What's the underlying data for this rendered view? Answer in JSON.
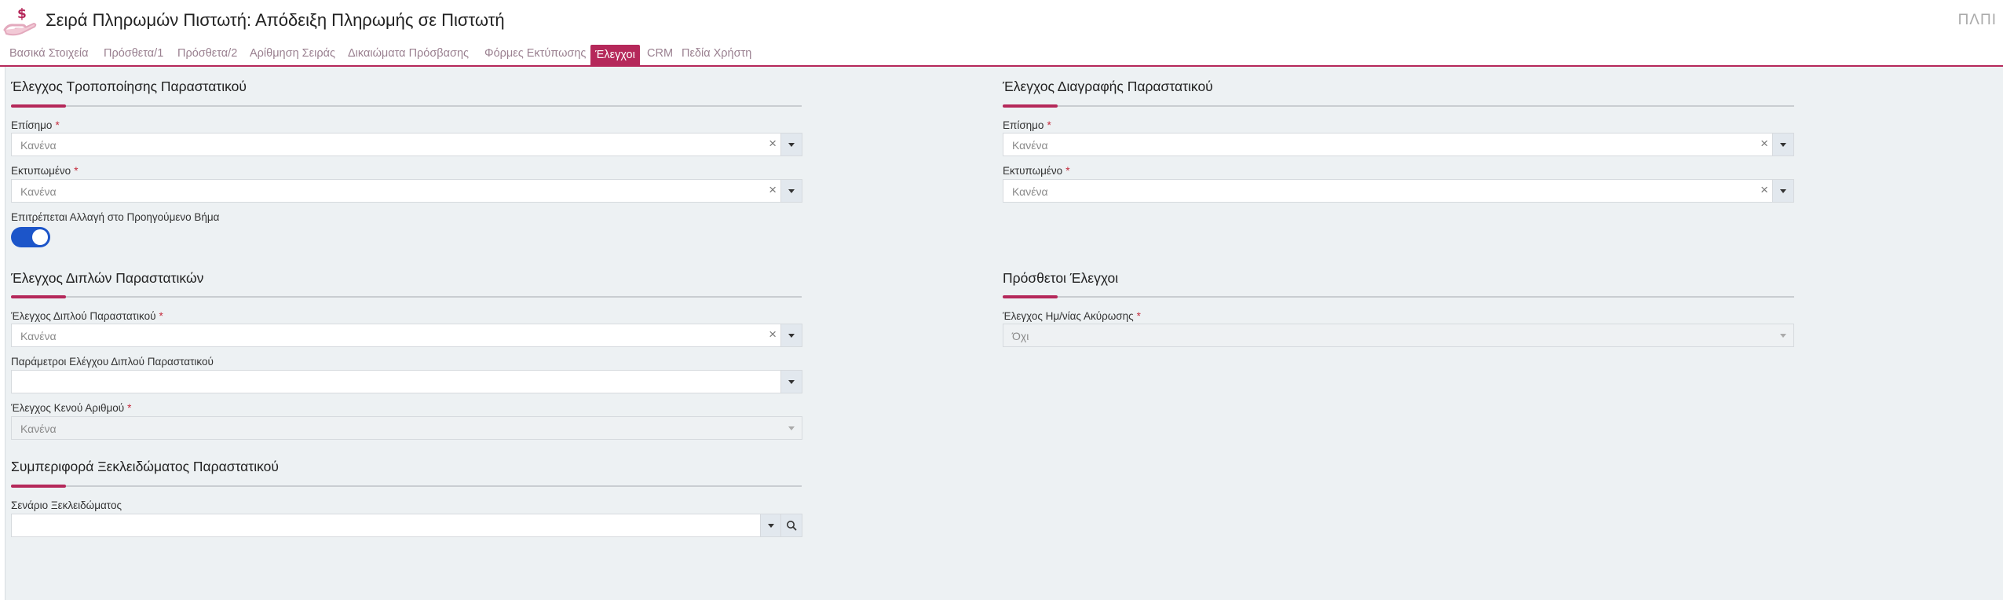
{
  "header": {
    "title": "Σειρά Πληρωμών Πιστωτή: Απόδειξη Πληρωμής σε Πιστωτή",
    "corner_label": "ΠΛΠΙ"
  },
  "tabs": [
    {
      "label": "Βασικά Στοιχεία"
    },
    {
      "label": "Πρόσθετα/1"
    },
    {
      "label": "Πρόσθετα/2"
    },
    {
      "label": "Αρίθμηση Σειράς"
    },
    {
      "label": "Δικαιώματα Πρόσβασης"
    },
    {
      "label": "Φόρμες Εκτύπωσης"
    },
    {
      "label": "Έλεγχοι"
    },
    {
      "label": "CRM"
    },
    {
      "label": "Πεδία Χρήστη"
    }
  ],
  "active_tab": "Έλεγχοι",
  "required_mark": "*",
  "left": {
    "modify": {
      "title": "Έλεγχος Τροποποίησης Παραστατικού",
      "official_label": "Επίσημο",
      "official_value": "Κανένα",
      "printed_label": "Εκτυπωμένο",
      "printed_value": "Κανένα",
      "allow_prev_label": "Επιτρέπεται Αλλαγή στο Προηγούμενο Βήμα",
      "allow_prev_on": true
    },
    "duplicates": {
      "title": "Έλεγχος Διπλών Παραστατικών",
      "dup_label": "Έλεγχος Διπλού Παραστατικού",
      "dup_value": "Κανένα",
      "params_label": "Παράμετροι Ελέγχου Διπλού Παραστατικού",
      "params_value": "",
      "gap_label": "Έλεγχος Κενού Αριθμού",
      "gap_value": "Κανένα"
    },
    "unlock": {
      "title": "Συμπεριφορά Ξεκλειδώματος Παραστατικού",
      "scenario_label": "Σενάριο Ξεκλειδώματος",
      "scenario_value": ""
    }
  },
  "right": {
    "delete": {
      "title": "Έλεγχος Διαγραφής Παραστατικού",
      "official_label": "Επίσημο",
      "official_value": "Κανένα",
      "printed_label": "Εκτυπωμένο",
      "printed_value": "Κανένα"
    },
    "extra": {
      "title": "Πρόσθετοι Έλεγχοι",
      "cancel_date_label": "Έλεγχος Ημ/νίας Ακύρωσης",
      "cancel_date_value": "Όχι"
    }
  },
  "colors": {
    "accent": "#b5285a",
    "toggle_on": "#1c55c9",
    "content_bg": "#edf1f3"
  },
  "icons": {
    "app": "hand-dollar-icon",
    "clear": "clear-x-icon",
    "dropdown": "chevron-down-icon",
    "search": "search-icon"
  }
}
